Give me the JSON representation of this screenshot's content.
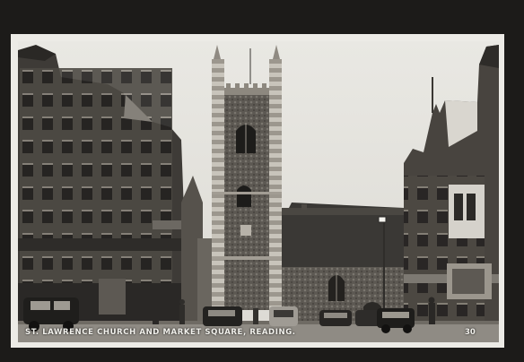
{
  "postcard": {
    "caption": "ST. LAWRENCE CHURCH AND MARKET SQUARE, READING.",
    "number": "30",
    "tone": "sepia",
    "colors": {
      "border": "#ecebe6",
      "frame": "#1c1b19",
      "sky": "#e4e3de",
      "stone": "#6e6a63",
      "shadow": "#2b2926"
    }
  }
}
